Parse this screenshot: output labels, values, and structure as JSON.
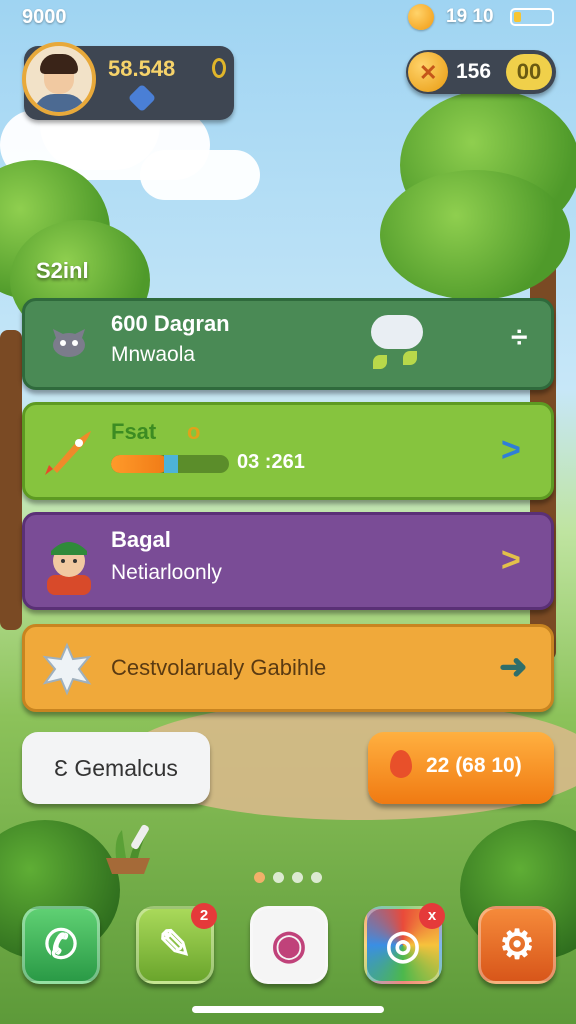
{
  "status_bar": {
    "time": "9000",
    "indicators": "19 10",
    "battery_level": 0.2
  },
  "profile": {
    "score": "58.548",
    "avatar_icon": "player-avatar-icon",
    "gem_icon": "gem-icon"
  },
  "resource": {
    "icon_label": "✕",
    "value": "156",
    "badge": "00"
  },
  "section_label": "S2inl",
  "cards": [
    {
      "title": "600 Dagran",
      "subtitle": "Mnwaola",
      "icon": "dragon-icon",
      "color": "#4a8a55"
    },
    {
      "title": "Fsat",
      "badge": "o",
      "timer": "03 :261",
      "progress": 0.48,
      "icon": "rocket-icon",
      "color": "#86c43e"
    },
    {
      "title": "Bagal",
      "subtitle": "Netiarloonly",
      "icon": "character-icon",
      "color": "#7a4c96"
    },
    {
      "subtitle": "Cestvolarualy Gabihle",
      "icon": "star-badge-icon",
      "color": "#f0a93a"
    }
  ],
  "buttons": {
    "left_label": "Ɛ Gemalcus",
    "right_label": "22 (68 10)"
  },
  "pager": {
    "count": 4,
    "active": 0
  },
  "dock": {
    "apps": [
      {
        "name": "phone-app",
        "badge": ""
      },
      {
        "name": "messages-app",
        "badge": "2"
      },
      {
        "name": "browser-app",
        "badge": ""
      },
      {
        "name": "camera-app",
        "badge": "x"
      },
      {
        "name": "settings-app",
        "badge": ""
      }
    ]
  }
}
